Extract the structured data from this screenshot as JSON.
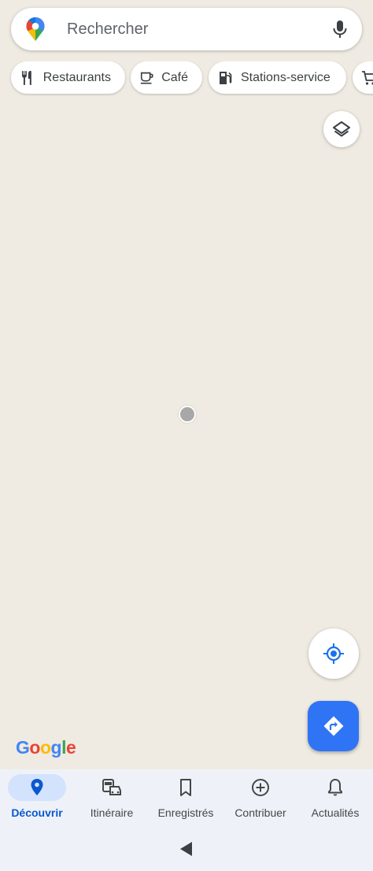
{
  "search": {
    "placeholder": "Rechercher",
    "logo_icon": "google-maps-pin-icon",
    "mic_icon": "microphone-icon"
  },
  "chips": [
    {
      "label": "Restaurants",
      "icon": "fork-knife-icon"
    },
    {
      "label": "Café",
      "icon": "coffee-cup-icon"
    },
    {
      "label": "Stations-service",
      "icon": "gas-pump-icon"
    },
    {
      "label": "",
      "icon": "shopping-cart-icon"
    }
  ],
  "map": {
    "background_color": "#efebe2",
    "layers_icon": "layers-icon",
    "recenter_icon": "my-location-icon",
    "directions_icon": "directions-icon",
    "attribution": "Google",
    "location_dot_color": "#a8a8a8"
  },
  "bottom_nav": {
    "items": [
      {
        "label": "Découvrir",
        "icon": "location-pin-icon",
        "active": true
      },
      {
        "label": "Itinéraire",
        "icon": "commute-icon",
        "active": false
      },
      {
        "label": "Enregistrés",
        "icon": "bookmark-icon",
        "active": false
      },
      {
        "label": "Contribuer",
        "icon": "add-circle-icon",
        "active": false
      },
      {
        "label": "Actualités",
        "icon": "bell-icon",
        "active": false
      }
    ]
  },
  "colors": {
    "accent": "#0b57d0",
    "fab": "#2f74f5",
    "nav_active_pill": "#d3e3fd",
    "nav_background": "#eef2f8"
  }
}
